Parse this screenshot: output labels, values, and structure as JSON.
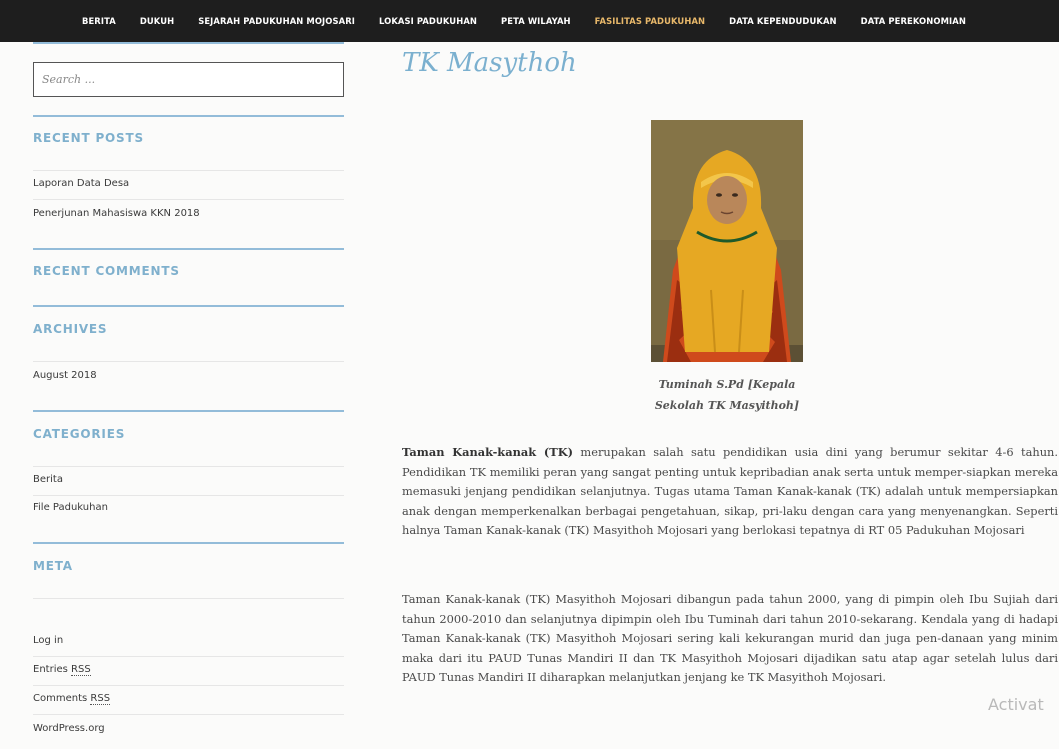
{
  "nav": {
    "items": [
      "BERITA",
      "DUKUH",
      "SEJARAH PADUKUHAN MOJOSARI",
      "LOKASI PADUKUHAN",
      "PETA WILAYAH",
      "FASILITAS PADUKUHAN",
      "DATA KEPENDUDUKAN",
      "DATA PEREKONOMIAN"
    ],
    "active_index": 5,
    "active_color": "#e8b86a"
  },
  "sidebar": {
    "search_placeholder": "Search ...",
    "recent_posts": {
      "heading": "RECENT POSTS",
      "items": [
        "Laporan Data Desa",
        "Penerjunan Mahasiswa KKN 2018"
      ]
    },
    "recent_comments": {
      "heading": "RECENT COMMENTS"
    },
    "archives": {
      "heading": "ARCHIVES",
      "items": [
        "August 2018"
      ]
    },
    "categories": {
      "heading": "CATEGORIES",
      "items": [
        "Berita",
        "File Padukuhan"
      ]
    },
    "meta": {
      "heading": "META",
      "log_in": "Log in",
      "entries_prefix": "Entries",
      "comments_prefix": "Comments",
      "rss": "RSS",
      "wordpress": "WordPress.org"
    },
    "accent_color": "#7fb0cd"
  },
  "main": {
    "title": "TK Masythoh",
    "caption_line1": "Tuminah S.Pd [Kepala",
    "caption_line2": "Sekolah TK Masyithoh]",
    "para1_bold": "Taman Kanak-kanak (TK)",
    "para1_rest": " merupakan salah satu pendidikan usia dini yang berumur sekitar 4-6 tahun. Pendidikan TK memiliki peran yang sangat penting untuk kepribadian anak serta untuk memper-siapkan mereka memasuki jenjang pendidikan selanjutnya. Tugas utama Taman Kanak-kanak (TK) adalah untuk mempersiapkan anak dengan memperkenalkan berbagai pengetahuan, sikap, pri-laku dengan cara yang menyenangkan. Seperti halnya Taman Kanak-kanak (TK) Masyithoh Mojosari yang berlokasi tepatnya di RT 05 Padukuhan Mojosari",
    "para2": "Taman Kanak-kanak (TK) Masyithoh Mojosari dibangun pada tahun 2000, yang di pimpin oleh Ibu Sujiah dari tahun 2000-2010 dan selanjutnya dipimpin oleh Ibu Tuminah dari tahun 2010-sekarang. Kendala yang di hadapi Taman Kanak-kanak (TK) Masyithoh Mojosari sering kali kekurangan murid dan juga pen-danaan yang minim maka dari itu PAUD Tunas Mandiri II dan TK Masyithoh Mojosari dijadikan satu atap agar setelah lulus dari PAUD Tunas Mandiri II diharapkan melanjutkan jenjang ke TK Masyithoh Mojosari."
  },
  "watermark": "Activat"
}
